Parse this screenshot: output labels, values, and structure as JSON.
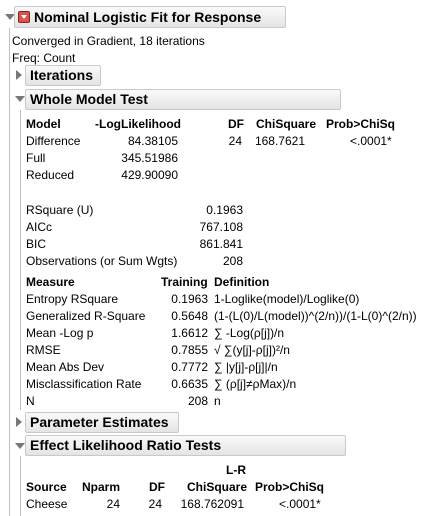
{
  "report": {
    "title": "Nominal Logistic Fit for Response",
    "converged": "Converged in Gradient, 18 iterations",
    "freq": "Freq: Count"
  },
  "iterations": {
    "title": "Iterations"
  },
  "whole_model": {
    "title": "Whole Model Test",
    "headers": [
      "Model",
      "-LogLikelihood",
      "DF",
      "ChiSquare",
      "Prob>ChiSq"
    ],
    "rows": [
      {
        "model": "Difference",
        "loglik": "84.38105",
        "df": "24",
        "chisq": "168.7621",
        "prob": "<.0001*"
      },
      {
        "model": "Full",
        "loglik": "345.51986"
      },
      {
        "model": "Reduced",
        "loglik": "429.90090"
      }
    ],
    "stats": [
      {
        "label": "RSquare (U)",
        "value": "0.1963"
      },
      {
        "label": "AICc",
        "value": "767.108"
      },
      {
        "label": "BIC",
        "value": "861.841"
      },
      {
        "label": "Observations (or Sum Wgts)",
        "value": "208"
      }
    ],
    "measure_headers": [
      "Measure",
      "Training",
      "Definition"
    ],
    "measures": [
      {
        "measure": "Entropy RSquare",
        "training": "0.1963",
        "definition": "1-Loglike(model)/Loglike(0)"
      },
      {
        "measure": "Generalized R-Square",
        "training": "0.5648",
        "definition": "(1-(L(0)/L(model))^(2/n))/(1-L(0)^(2/n))"
      },
      {
        "measure": "Mean -Log p",
        "training": "1.6612",
        "definition": "∑ -Log(ρ[j])/n"
      },
      {
        "measure": "RMSE",
        "training": "0.7855",
        "definition": "√ ∑(y[j]-ρ[j])²/n"
      },
      {
        "measure": "Mean Abs Dev",
        "training": "0.7772",
        "definition": "∑ |y[j]-ρ[j]|/n"
      },
      {
        "measure": "Misclassification Rate",
        "training": "0.6635",
        "definition": "∑ (ρ[j]≠ρMax)/n"
      },
      {
        "measure": "N",
        "training": "208",
        "definition": "n"
      }
    ]
  },
  "param_estimates": {
    "title": "Parameter Estimates"
  },
  "effect_lr": {
    "title": "Effect Likelihood Ratio Tests",
    "lr_header": "L-R",
    "headers": [
      "Source",
      "Nparm",
      "DF",
      "ChiSquare",
      "Prob>ChiSq"
    ],
    "rows": [
      {
        "source": "Cheese",
        "nparm": "24",
        "df": "24",
        "chisq": "168.762091",
        "prob": "<.0001*"
      }
    ]
  }
}
